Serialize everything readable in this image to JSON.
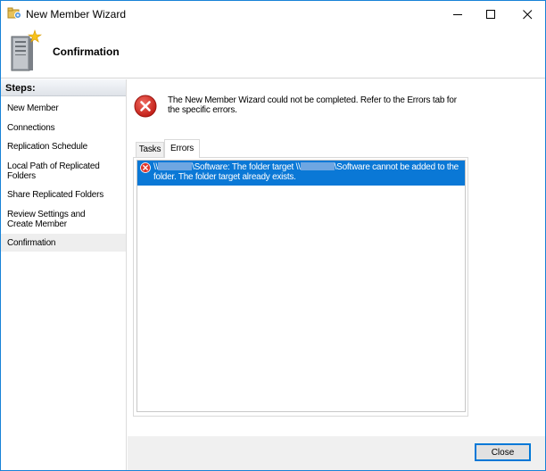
{
  "window": {
    "title": "New Member Wizard",
    "controls": {
      "minimize": "minimize",
      "maximize": "maximize",
      "close": "close"
    }
  },
  "header": {
    "title": "Confirmation",
    "icon": "server-icon"
  },
  "sidebar": {
    "heading": "Steps:",
    "items": [
      {
        "label": "New Member",
        "active": false
      },
      {
        "label": "Connections",
        "active": false
      },
      {
        "label": "Replication Schedule",
        "active": false
      },
      {
        "label": "Local Path of Replicated Folders",
        "active": false
      },
      {
        "label": "Share Replicated Folders",
        "active": false
      },
      {
        "label": "Review Settings and Create Member",
        "active": false
      },
      {
        "label": "Confirmation",
        "active": true
      }
    ]
  },
  "main": {
    "message": "The New Member Wizard could not be completed. Refer to the Errors tab for the specific errors.",
    "tabs": [
      {
        "label": "Tasks",
        "selected": false
      },
      {
        "label": "Errors",
        "selected": true
      }
    ],
    "errors": [
      {
        "prefix": "\\\\",
        "part1": "\\Software: The folder target \\\\",
        "part2": "\\Software cannot be added to the folder. The folder target already exists."
      }
    ]
  },
  "footer": {
    "close_label": "Close"
  },
  "colors": {
    "accent": "#0078d7",
    "selection": "#0a78d6",
    "error_red": "#d9302c"
  }
}
